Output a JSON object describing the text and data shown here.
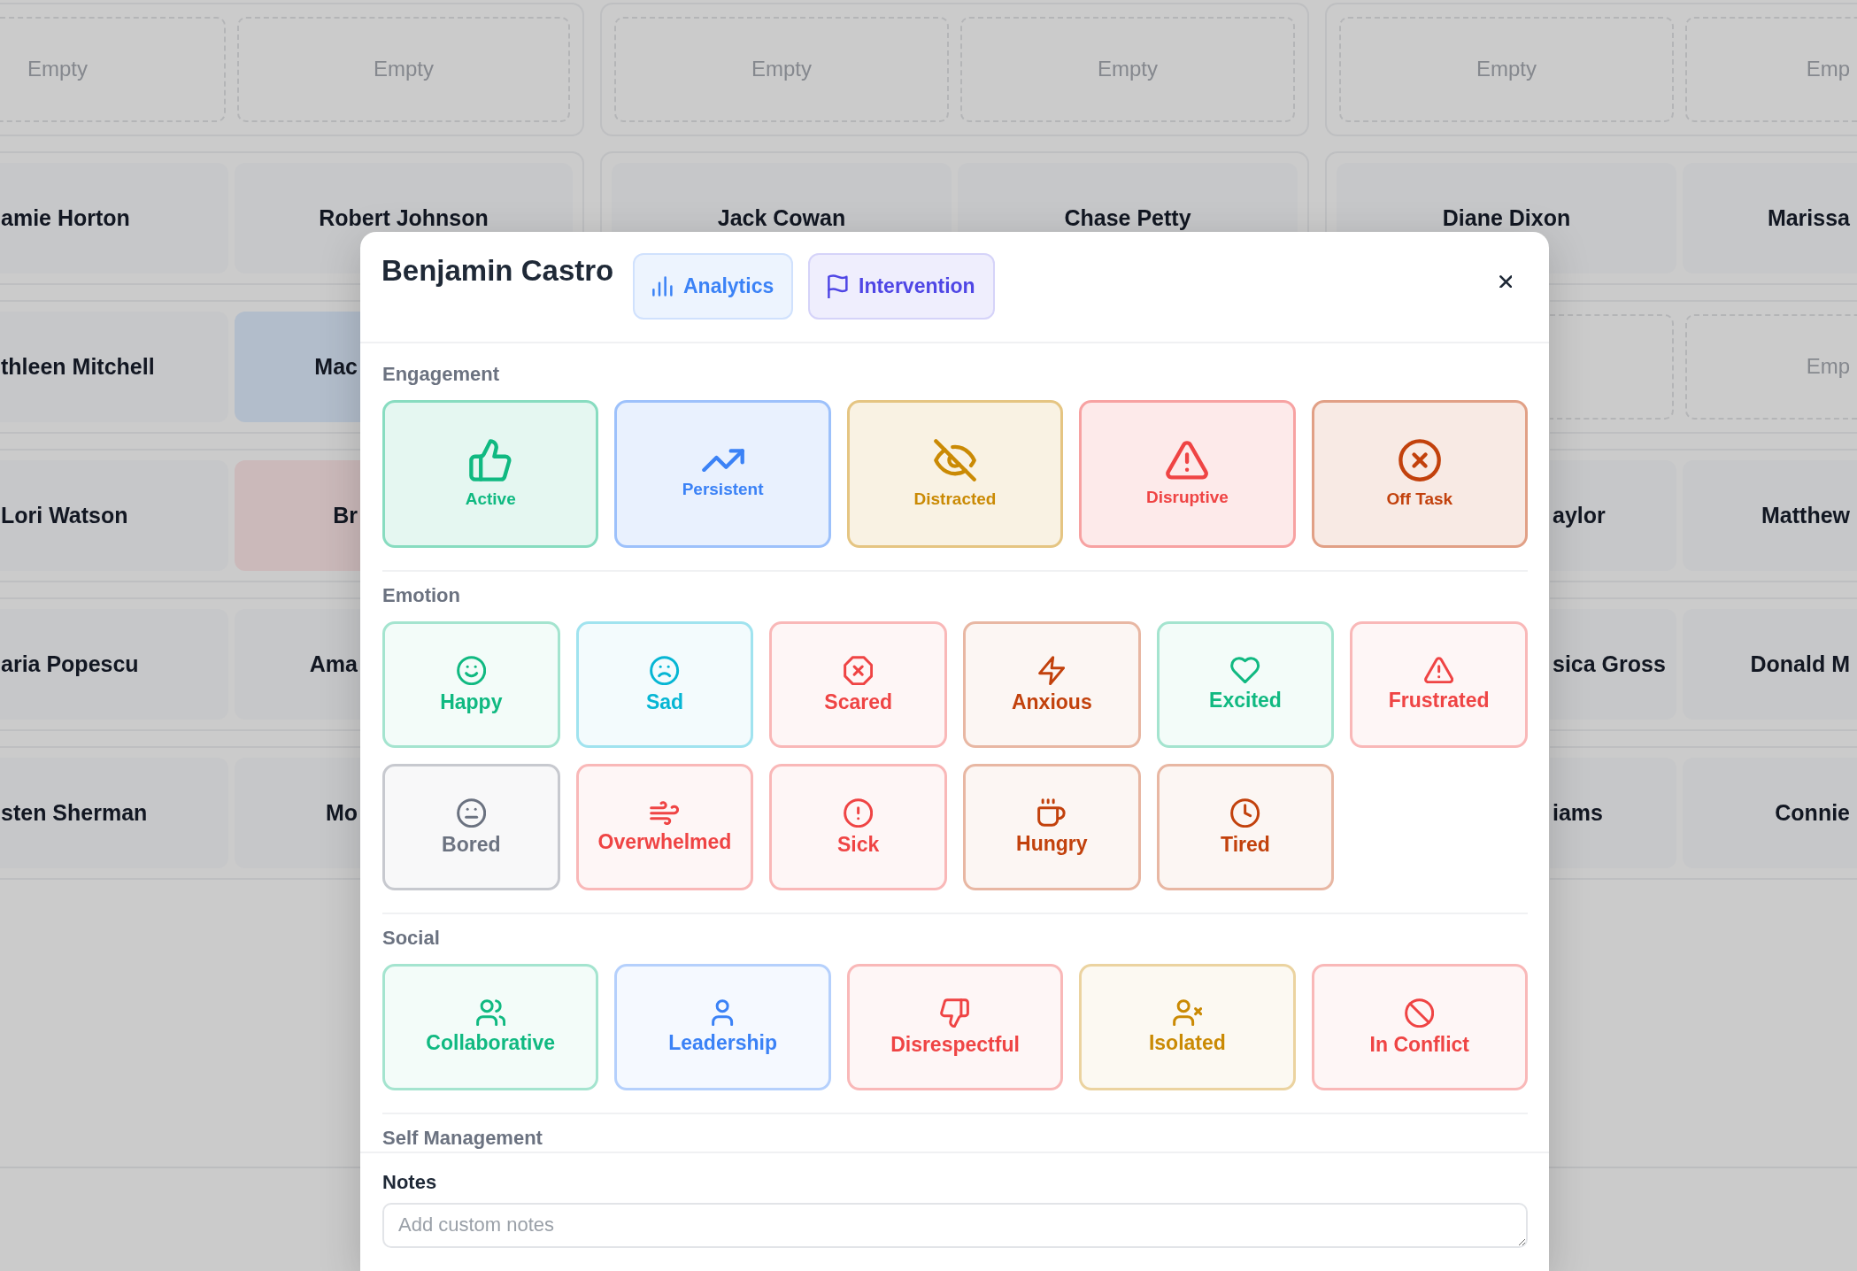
{
  "seating_chart": {
    "rows": [
      {
        "groups": [
          {
            "seats": [
              {
                "kind": "empty",
                "label": "Empty"
              },
              {
                "kind": "empty",
                "label": "Empty"
              }
            ]
          },
          {
            "seats": [
              {
                "kind": "empty",
                "label": "Empty"
              },
              {
                "kind": "empty",
                "label": "Empty"
              }
            ]
          },
          {
            "seats": [
              {
                "kind": "empty",
                "label": "Empty"
              },
              {
                "kind": "empty",
                "label": "Emp"
              }
            ]
          }
        ]
      },
      {
        "groups": [
          {
            "seats": [
              {
                "kind": "student",
                "name": "amie Horton",
                "color": "#c6c7c9"
              },
              {
                "kind": "student",
                "name": "Robert Johnson",
                "color": "#c6c7c9"
              }
            ]
          },
          {
            "seats": [
              {
                "kind": "student",
                "name": "Jack Cowan",
                "color": "#c6c7c9"
              },
              {
                "kind": "student",
                "name": "Chase Petty",
                "color": "#c6c7c9"
              }
            ]
          },
          {
            "seats": [
              {
                "kind": "student",
                "name": "Diane Dixon",
                "color": "#c6c7c9"
              },
              {
                "kind": "student",
                "name": "Marissa",
                "color": "#c6c7c9"
              }
            ]
          }
        ]
      },
      {
        "groups": [
          {
            "seats": [
              {
                "kind": "student",
                "name": "thleen Mitchell",
                "color": "#c6c7c9"
              },
              {
                "kind": "student",
                "name": "Mac",
                "color": "#b2bdcb"
              }
            ]
          },
          {
            "seats": [
              {
                "kind": "empty"
              },
              {
                "kind": "empty",
                "label": "Emp"
              }
            ]
          }
        ]
      },
      {
        "groups": [
          {
            "seats": [
              {
                "kind": "student",
                "name": "Lori Watson",
                "color": "#c6c7c9"
              },
              {
                "kind": "student",
                "name": "Br",
                "color": "#cbb9ba"
              }
            ]
          },
          {
            "seats": [
              {
                "kind": "student",
                "name": "aylor",
                "color": "#c6c7c9"
              },
              {
                "kind": "student",
                "name": "Matthew",
                "color": "#c6c7c9"
              }
            ]
          }
        ]
      },
      {
        "groups": [
          {
            "seats": [
              {
                "kind": "student",
                "name": "aria Popescu",
                "color": "#c6c7c9"
              },
              {
                "kind": "student",
                "name": "Ama",
                "color": "#c6c7c9"
              }
            ]
          },
          {
            "seats": [
              {
                "kind": "student",
                "name": "sica Gross",
                "color": "#c6c7c9"
              },
              {
                "kind": "student",
                "name": "Donald M",
                "color": "#c6c7c9"
              }
            ]
          }
        ]
      },
      {
        "groups": [
          {
            "seats": [
              {
                "kind": "student",
                "name": "sten Sherman",
                "color": "#c6c7c9"
              },
              {
                "kind": "student",
                "name": "Mo",
                "color": "#c6c7c9"
              }
            ]
          },
          {
            "seats": [
              {
                "kind": "student",
                "name": "iams",
                "color": "#c6c7c9"
              },
              {
                "kind": "student",
                "name": "Connie",
                "color": "#c6c7c9"
              }
            ]
          }
        ]
      }
    ]
  },
  "modal": {
    "title": "Benjamin Castro",
    "header_buttons": [
      {
        "label": "Analytics",
        "color": "#3b82f6"
      },
      {
        "label": "Intervention",
        "color": "#4f46e5"
      }
    ],
    "sections": [
      {
        "title": "Engagement",
        "kind": "large",
        "items": [
          {
            "label": "Active",
            "color": "#10b981",
            "selected": false
          },
          {
            "label": "Persistent",
            "color": "#3b82f6",
            "selected": false
          },
          {
            "label": "Distracted",
            "color": "#ca8a04",
            "selected": false
          },
          {
            "label": "Disruptive",
            "color": "#ef4444",
            "selected": false
          },
          {
            "label": "Off Task",
            "color": "#c2410c",
            "selected": false
          }
        ]
      },
      {
        "title": "Emotion",
        "kind": "compact",
        "items": [
          {
            "label": "Happy",
            "color": "#10b981",
            "selected": false
          },
          {
            "label": "Sad",
            "color": "#06b6d4",
            "selected": false
          },
          {
            "label": "Scared",
            "color": "#ef4444",
            "selected": false
          },
          {
            "label": "Anxious",
            "color": "#c2410c",
            "selected": false
          },
          {
            "label": "Excited",
            "color": "#10b981",
            "selected": false
          },
          {
            "label": "Frustrated",
            "color": "#ef4444",
            "selected": false
          },
          {
            "label": "Bored",
            "color": "#6b7280",
            "selected": false
          },
          {
            "label": "Overwhelmed",
            "color": "#ef4444",
            "selected": false
          },
          {
            "label": "Sick",
            "color": "#ef4444",
            "selected": false
          },
          {
            "label": "Hungry",
            "color": "#c2410c",
            "selected": false
          },
          {
            "label": "Tired",
            "color": "#c2410c",
            "selected": false
          }
        ]
      },
      {
        "title": "Social",
        "kind": "compact",
        "items": [
          {
            "label": "Collaborative",
            "color": "#10b981",
            "selected": false
          },
          {
            "label": "Leadership",
            "color": "#3b82f6",
            "selected": false
          },
          {
            "label": "Disrespectful",
            "color": "#ef4444",
            "selected": false
          },
          {
            "label": "Isolated",
            "color": "#ca8a04",
            "selected": false
          },
          {
            "label": "In Conflict",
            "color": "#ef4444",
            "selected": false
          }
        ]
      },
      {
        "title": "Self Management"
      }
    ],
    "notes": {
      "label": "Notes",
      "placeholder": "Add custom notes"
    }
  }
}
